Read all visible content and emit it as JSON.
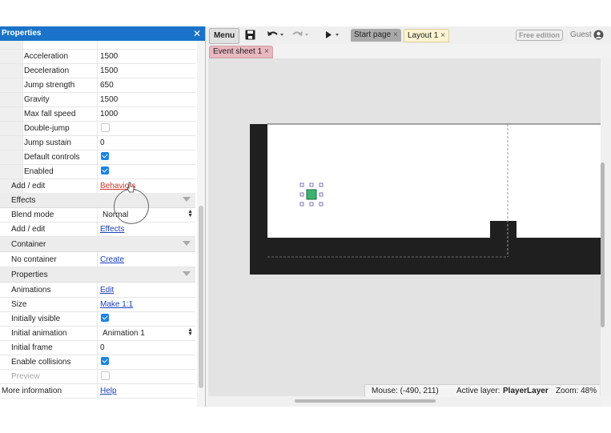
{
  "properties_panel": {
    "title": "Properties",
    "close_icon": "close-icon",
    "rows": {
      "acceleration": {
        "label": "Acceleration",
        "value": "1500"
      },
      "deceleration": {
        "label": "Deceleration",
        "value": "1500"
      },
      "jump_strength": {
        "label": "Jump strength",
        "value": "650"
      },
      "gravity": {
        "label": "Gravity",
        "value": "1500"
      },
      "max_fall_speed": {
        "label": "Max fall speed",
        "value": "1000"
      },
      "double_jump": {
        "label": "Double-jump",
        "checked": false
      },
      "jump_sustain": {
        "label": "Jump sustain",
        "value": "0"
      },
      "default_controls": {
        "label": "Default controls",
        "checked": true
      },
      "enabled": {
        "label": "Enabled",
        "checked": true
      },
      "add_edit_behaviors": {
        "label": "Add / edit",
        "link": "Behaviors"
      },
      "effects_header": {
        "label": "Effects"
      },
      "blend_mode": {
        "label": "Blend mode",
        "value": "Normal"
      },
      "add_edit_effects": {
        "label": "Add / edit",
        "link": "Effects"
      },
      "container_header": {
        "label": "Container"
      },
      "no_container": {
        "label": "No container",
        "link": "Create"
      },
      "properties_header": {
        "label": "Properties"
      },
      "animations": {
        "label": "Animations",
        "link": "Edit"
      },
      "size": {
        "label": "Size",
        "link": "Make 1:1"
      },
      "initially_visible": {
        "label": "Initially visible",
        "checked": true
      },
      "initial_animation": {
        "label": "Initial animation",
        "value": "Animation 1"
      },
      "initial_frame": {
        "label": "Initial frame",
        "value": "0"
      },
      "enable_collisions": {
        "label": "Enable collisions",
        "checked": true
      },
      "preview": {
        "label": "Preview",
        "checked": false
      },
      "more_information": {
        "label": "More information",
        "link": "Help"
      }
    }
  },
  "toolbar": {
    "menu_label": "Menu",
    "save_icon": "save-icon",
    "undo_icon": "undo-icon",
    "redo_icon": "redo-icon",
    "play_icon": "play-icon",
    "tabs": [
      {
        "label": "Start page",
        "active": false
      },
      {
        "label": "Layout 1",
        "active": true
      }
    ],
    "free_edition_label": "Free edition",
    "guest_label": "Guest",
    "user_icon": "user-icon"
  },
  "subtabs": [
    {
      "label": "Event sheet 1"
    }
  ],
  "status_bar": {
    "mouse": "Mouse: (-490, 211)",
    "active_layer_label": "Active layer:",
    "active_layer_value": "PlayerLayer",
    "zoom": "Zoom: 48%"
  },
  "colors": {
    "panel_header": "#1a73c8",
    "checkbox": "#1a84e6",
    "link": "#1a3fbf",
    "active_link": "#d8342a",
    "layout_tab": "#fbf3cf",
    "event_tab": "#e9b8be",
    "player_sprite": "#3cb371",
    "ground": "#222222"
  }
}
